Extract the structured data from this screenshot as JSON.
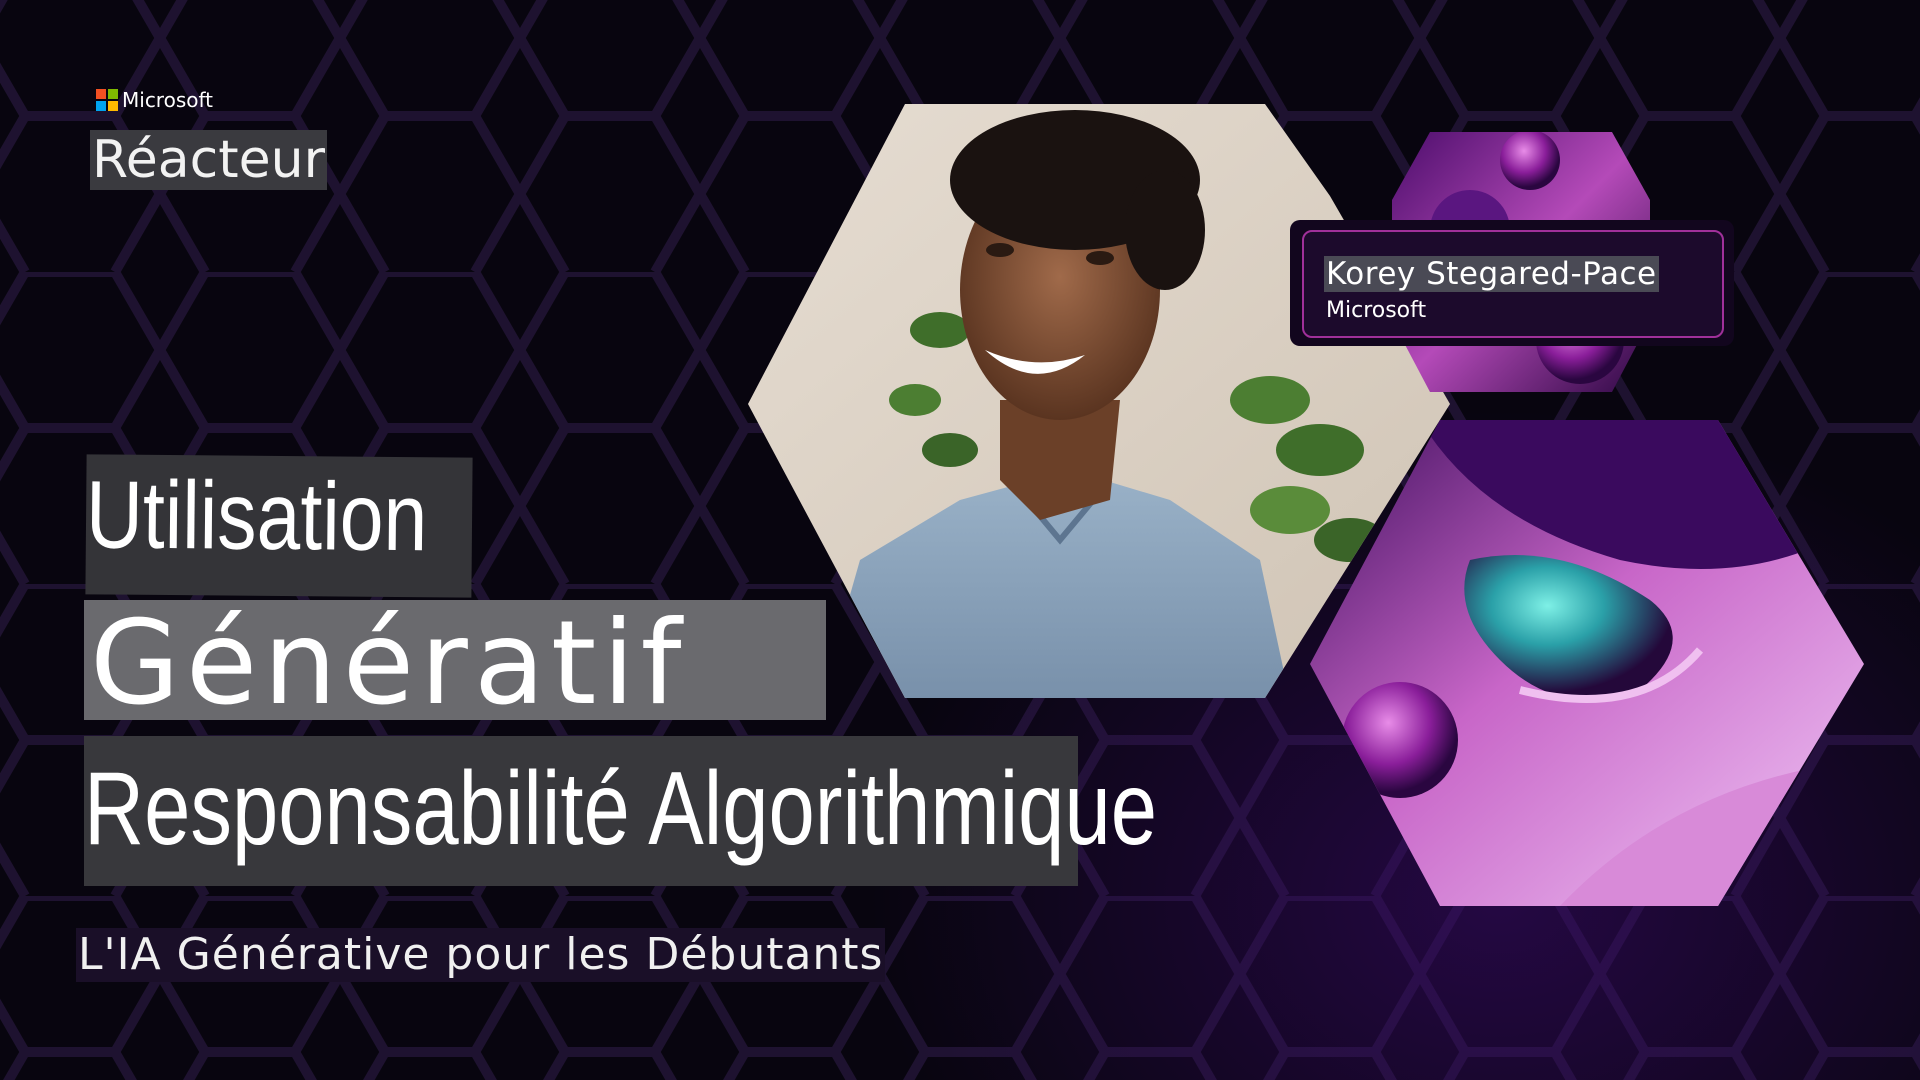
{
  "logo": {
    "company": "Microsoft",
    "colors": [
      "#f25022",
      "#7fba00",
      "#00a4ef",
      "#ffb900"
    ]
  },
  "brand": "Réacteur",
  "title": {
    "line1": "Utilisation",
    "line2": "Génératif",
    "line3": "Responsabilité Algorithmique"
  },
  "subtitle": "L'IA Générative pour les Débutants",
  "speaker": {
    "name": "Korey Stegared-Pace",
    "organization": "Microsoft"
  },
  "colors": {
    "background": "#08050f",
    "hex_outline": "#1e1230",
    "accent": "#a0309a",
    "title_bg": "#343438"
  },
  "images": [
    "speaker-photo",
    "abstract-purple-spheres-top",
    "abstract-purple-spheres-bottom"
  ]
}
